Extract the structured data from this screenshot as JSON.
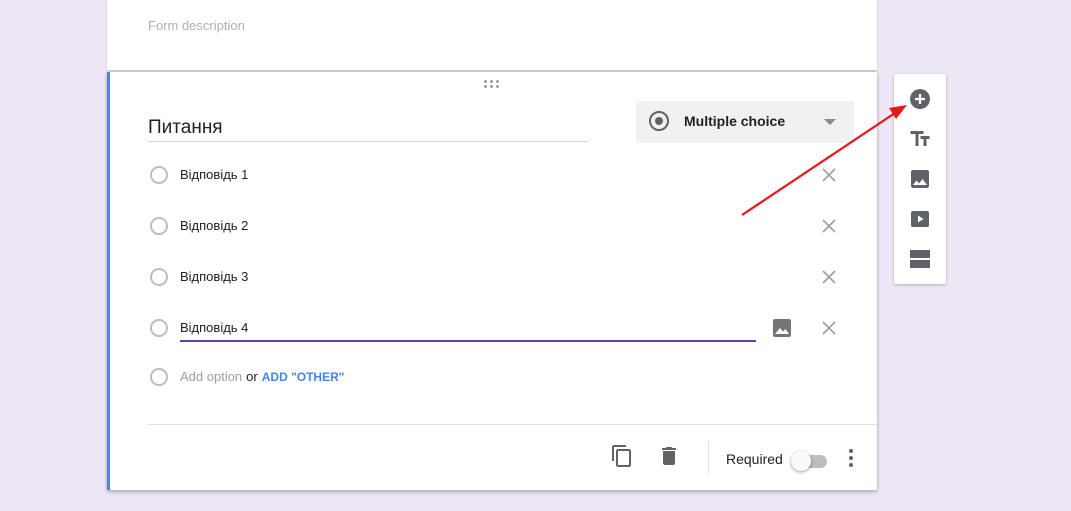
{
  "header": {
    "form_description_placeholder": "Form description"
  },
  "question": {
    "title": "Питання",
    "type_label": "Multiple choice",
    "options": [
      {
        "label": "Відповідь 1"
      },
      {
        "label": "Відповідь 2"
      },
      {
        "label": "Відповідь 3"
      },
      {
        "label": "Відповідь 4"
      }
    ],
    "add_option_label": "Add option",
    "or_label": "or",
    "add_other_label": "ADD \"OTHER\"",
    "required_label": "Required",
    "required_on": false
  },
  "toolbar": {
    "items": [
      {
        "icon": "add-circle-icon"
      },
      {
        "icon": "title-text-icon"
      },
      {
        "icon": "image-icon"
      },
      {
        "icon": "video-icon"
      },
      {
        "icon": "section-icon"
      }
    ]
  },
  "colors": {
    "background": "#ede7f6",
    "accent_blue": "#4285f4",
    "active_underline": "#673ab7",
    "annotation_arrow": "#e8161b"
  }
}
